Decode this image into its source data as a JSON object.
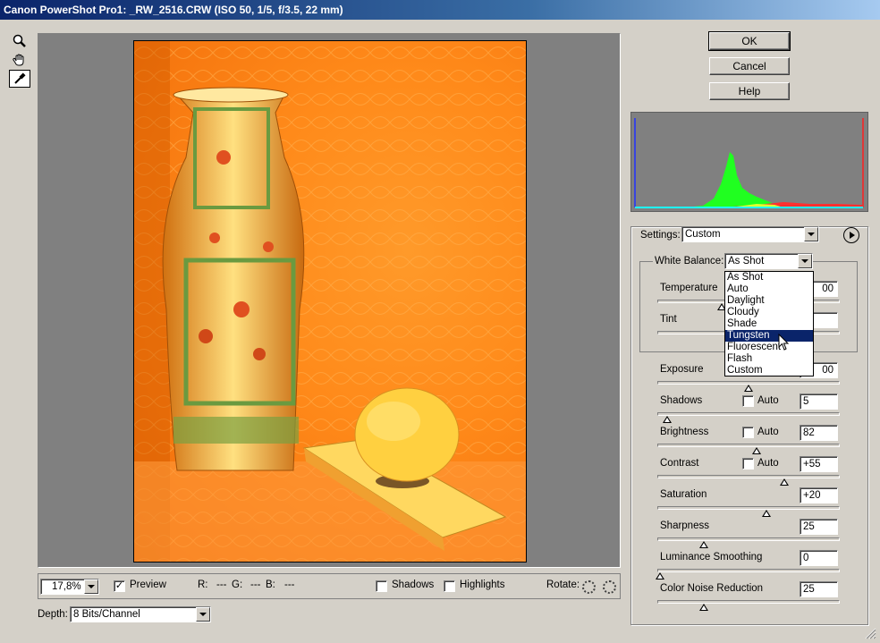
{
  "window": {
    "title": "Canon PowerShot Pro1:  _RW_2516.CRW  (ISO 50, 1/5, f/3.5, 22 mm)"
  },
  "tools": [
    {
      "name": "zoom-tool",
      "icon": "magnifier-icon"
    },
    {
      "name": "hand-tool",
      "icon": "hand-icon"
    },
    {
      "name": "white-balance-tool",
      "icon": "eyedropper-icon"
    }
  ],
  "buttons": {
    "ok": "OK",
    "cancel": "Cancel",
    "help": "Help"
  },
  "settings": {
    "label": "Settings:",
    "value": "Custom"
  },
  "white_balance": {
    "label": "White Balance:",
    "value": "As Shot",
    "options": [
      "As Shot",
      "Auto",
      "Daylight",
      "Cloudy",
      "Shade",
      "Tungsten",
      "Fluorescent",
      "Flash",
      "Custom"
    ],
    "highlighted": "Tungsten"
  },
  "adjustments": {
    "temperature": {
      "label": "Temperature",
      "value": "00"
    },
    "tint": {
      "label": "Tint",
      "value": ""
    },
    "exposure": {
      "label": "Exposure",
      "value": "00"
    },
    "shadows": {
      "label": "Shadows",
      "auto": "Auto",
      "value": "5"
    },
    "brightness": {
      "label": "Brightness",
      "auto": "Auto",
      "value": "82"
    },
    "contrast": {
      "label": "Contrast",
      "auto": "Auto",
      "value": "+55"
    },
    "saturation": {
      "label": "Saturation",
      "value": "+20"
    },
    "sharpness": {
      "label": "Sharpness",
      "value": "25"
    },
    "luminance_smoothing": {
      "label": "Luminance Smoothing",
      "value": "0"
    },
    "color_noise_reduction": {
      "label": "Color Noise Reduction",
      "value": "25"
    }
  },
  "bottom": {
    "zoom": "17,8%",
    "preview": "Preview",
    "r_label": "R:",
    "r_value": "---",
    "g_label": "G:",
    "g_value": "---",
    "b_label": "B:",
    "b_value": "---",
    "shadows": "Shadows",
    "highlights": "Highlights",
    "rotate": "Rotate:"
  },
  "depth": {
    "label": "Depth:",
    "value": "8 Bits/Channel"
  },
  "colors": {
    "titlebar": "#0a246a",
    "selection": "#0a246a",
    "photo_tint": "#ff8a1a"
  }
}
